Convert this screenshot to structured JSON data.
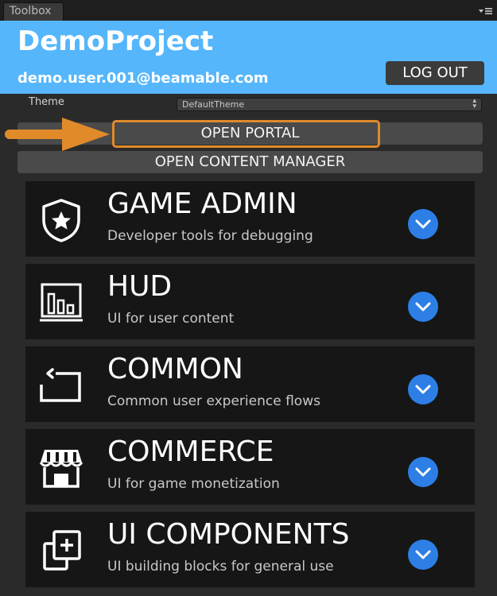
{
  "window": {
    "tab_label": "Toolbox"
  },
  "header": {
    "project_name": "DemoProject",
    "user_email": "demo.user.001@beamable.com",
    "logout_label": "LOG OUT"
  },
  "theme": {
    "label": "Theme",
    "selected": "DefaultTheme"
  },
  "buttons": {
    "open_portal": "OPEN PORTAL",
    "open_content_manager": "OPEN CONTENT MANAGER"
  },
  "sections": [
    {
      "title": "GAME ADMIN",
      "subtitle": "Developer tools for debugging",
      "icon": "shield-star-icon"
    },
    {
      "title": "HUD",
      "subtitle": "UI for user content",
      "icon": "bar-chart-icon"
    },
    {
      "title": "COMMON",
      "subtitle": "Common user experience flows",
      "icon": "return-arrow-icon"
    },
    {
      "title": "COMMERCE",
      "subtitle": "UI for game monetization",
      "icon": "storefront-icon"
    },
    {
      "title": "UI COMPONENTS",
      "subtitle": "UI building blocks for general use",
      "icon": "add-layers-icon"
    }
  ],
  "colors": {
    "header_bg": "#55b6fb",
    "highlight": "#e08a2a",
    "expand_button": "#2d7fe6"
  }
}
